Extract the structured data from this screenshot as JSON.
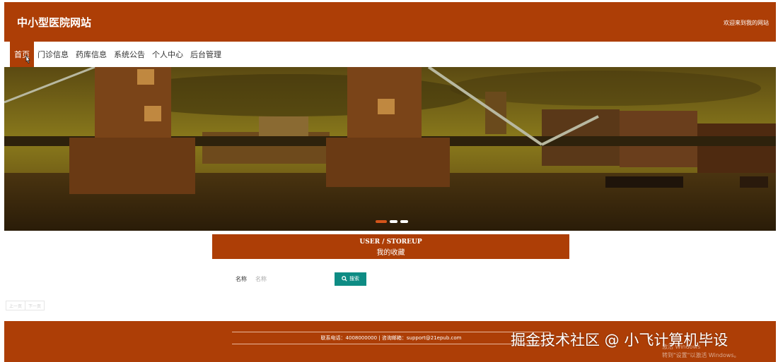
{
  "header": {
    "title": "中小型医院网站",
    "welcome": "欢迎来到我的网站"
  },
  "nav": {
    "items": [
      {
        "label": "首页"
      },
      {
        "label": "门诊信息"
      },
      {
        "label": "药库信息"
      },
      {
        "label": "系统公告"
      },
      {
        "label": "个人中心"
      },
      {
        "label": "后台管理"
      }
    ]
  },
  "banner": {
    "slide_count": 3,
    "active_slide": 1
  },
  "section": {
    "title_en": "USER / STOREUP",
    "title_cn": "我的收藏"
  },
  "search": {
    "label": "名称",
    "placeholder": "名称",
    "button_label": "搜索"
  },
  "pager": {
    "prev_label": "上一页",
    "next_label": "下一页"
  },
  "footer": {
    "contact": "联系电话：4008000000 | 咨询邮箱：support@21epub.com"
  },
  "overlay": {
    "watermark": "掘金技术社区 @ 小飞计算机毕设",
    "activate_line1": "激活 Windows",
    "activate_line2": "转到\"设置\"以激活 Windows。"
  },
  "colors": {
    "brand": "#ad3e06",
    "search_button": "#0e8c84"
  }
}
